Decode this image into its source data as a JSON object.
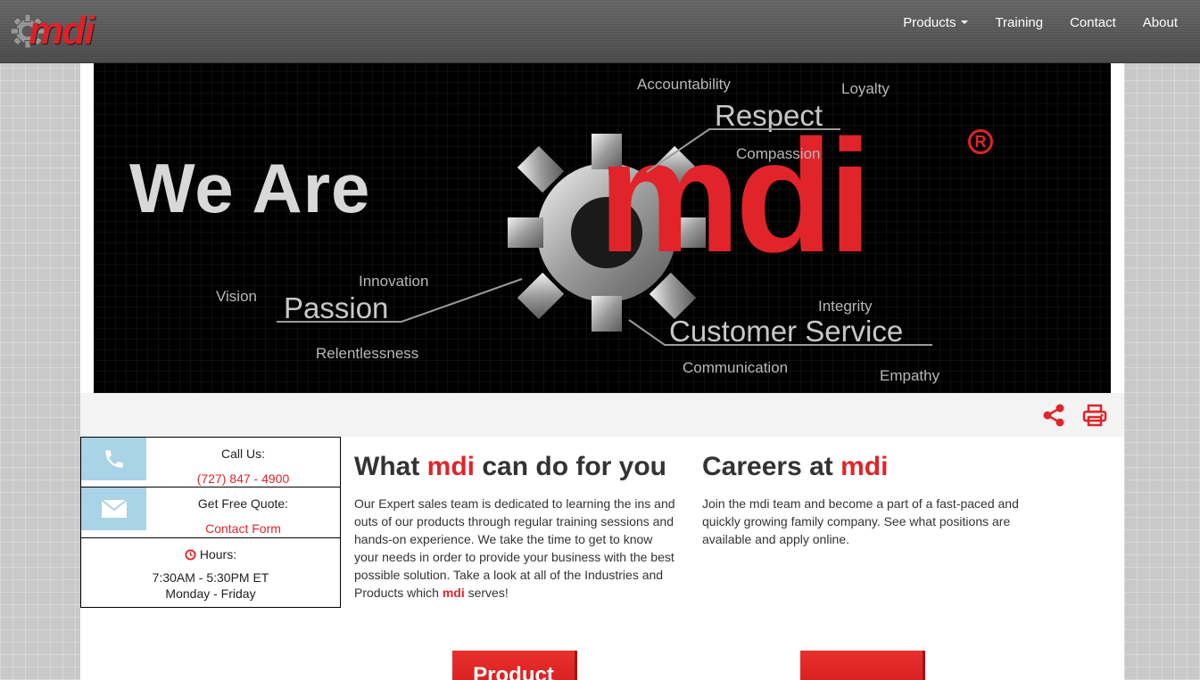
{
  "brand": {
    "logo_text": "mdi"
  },
  "nav": {
    "items": [
      {
        "label": "Products",
        "has_dropdown": true
      },
      {
        "label": "Training"
      },
      {
        "label": "Contact"
      },
      {
        "label": "About"
      }
    ]
  },
  "hero": {
    "headline": "We Are",
    "brand": "mdi",
    "registered": "R",
    "words": {
      "accountability": "Accountability",
      "loyalty": "Loyalty",
      "respect": "Respect",
      "compassion": "Compassion",
      "innovation": "Innovation",
      "vision": "Vision",
      "passion": "Passion",
      "relentlessness": "Relentlessness",
      "integrity": "Integrity",
      "customer_service": "Customer Service",
      "communication": "Communication",
      "empathy": "Empathy"
    }
  },
  "contact": {
    "call_label": "Call Us:",
    "phone": "(727) 847 - 4900",
    "quote_label": "Get Free Quote:",
    "quote_link": "Contact Form",
    "hours_label": "Hours:",
    "hours_time": "7:30AM - 5:30PM ET",
    "hours_days": "Monday - Friday"
  },
  "section_what": {
    "title_pre": "What ",
    "title_brand": "mdi",
    "title_post": " can do for you",
    "body": "Our Expert sales team is dedicated to learning the ins and outs of our products through regular training sessions and hands-on experience. We take the time to get to know your needs in order to provide your business with the best possible solution. Take a look at all of the Industries and Products which ",
    "body_brand": "mdi",
    "body_post": " serves!"
  },
  "section_careers": {
    "title_pre": "Careers at ",
    "title_brand": "mdi",
    "body": "Join the mdi team and become a part of a fast-paced and quickly growing family company. See what positions are available and apply online."
  },
  "buttons": {
    "product": "Product",
    "careers": ""
  },
  "colors": {
    "brand_red": "#e0242a",
    "icon_blue": "#a9d3e6",
    "nav_bg": "#5a5a5a"
  }
}
